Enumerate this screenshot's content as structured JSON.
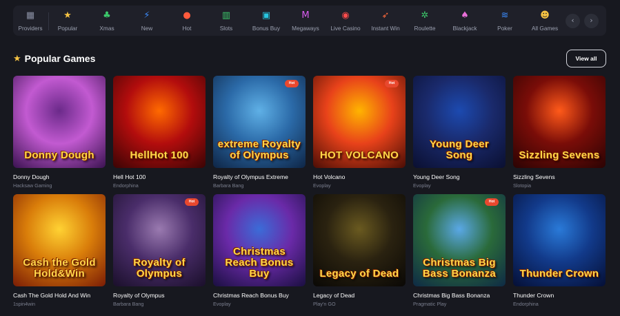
{
  "nav": {
    "items": [
      {
        "label": "Providers",
        "icon": "grid-icon",
        "glyph": "▦",
        "color": "#8a8fa3"
      },
      {
        "label": "Popular",
        "icon": "star-icon",
        "glyph": "★",
        "color": "#f6c343"
      },
      {
        "label": "Xmas",
        "icon": "christmas-tree-icon",
        "glyph": "♣",
        "color": "#3cc96b"
      },
      {
        "label": "New",
        "icon": "lightning-icon",
        "glyph": "⚡",
        "color": "#3b8cff"
      },
      {
        "label": "Hot",
        "icon": "flame-icon",
        "glyph": "●",
        "color": "#ff5a3c"
      },
      {
        "label": "Slots",
        "icon": "slot-reels-icon",
        "glyph": "▥",
        "color": "#3cc96b"
      },
      {
        "label": "Bonus Buy",
        "icon": "bonus-buy-icon",
        "glyph": "▣",
        "color": "#27c6e0"
      },
      {
        "label": "Megaways",
        "icon": "megaways-icon",
        "glyph": "M",
        "color": "#d95cf0"
      },
      {
        "label": "Live Casino",
        "icon": "live-casino-icon",
        "glyph": "◉",
        "color": "#ff4b4b"
      },
      {
        "label": "Instant Win",
        "icon": "rocket-icon",
        "glyph": "➶",
        "color": "#ff6a3c"
      },
      {
        "label": "Roulette",
        "icon": "roulette-icon",
        "glyph": "✲",
        "color": "#3cc96b"
      },
      {
        "label": "Blackjack",
        "icon": "spade-icon",
        "glyph": "♠",
        "color": "#e86fd8"
      },
      {
        "label": "Poker",
        "icon": "poker-chips-icon",
        "glyph": "≋",
        "color": "#3b8cff"
      },
      {
        "label": "All Games",
        "icon": "smiley-icon",
        "glyph": "☻",
        "color": "#f6c343"
      }
    ],
    "prev_glyph": "‹",
    "next_glyph": "›"
  },
  "section": {
    "title": "Popular Games",
    "view_all": "View all"
  },
  "games": [
    {
      "name": "Donny Dough",
      "provider": "Hacksaw Gaming",
      "art_title": "Donny Dough",
      "colors": [
        "#6b2a8a",
        "#c25ad1",
        "#3a1250"
      ]
    },
    {
      "name": "Hell Hot 100",
      "provider": "Endorphina",
      "art_title": "HellHot 100",
      "colors": [
        "#ff6a00",
        "#b30d0d",
        "#3a0404"
      ]
    },
    {
      "name": "Royalty of Olympus Extreme",
      "provider": "Barbara Bang",
      "art_title": "extreme Royalty of Olympus",
      "colors": [
        "#5fb0e6",
        "#2b6aa8",
        "#0e2545"
      ],
      "badge": "Hot"
    },
    {
      "name": "Hot Volcano",
      "provider": "Evoplay",
      "art_title": "HOT VOLCANO",
      "colors": [
        "#ffb400",
        "#e8421a",
        "#4a0d05"
      ],
      "badge": "Hot"
    },
    {
      "name": "Young Deer Song",
      "provider": "Evoplay",
      "art_title": "Young Deer Song",
      "colors": [
        "#1c4ab0",
        "#1a2a6c",
        "#0a0f30"
      ]
    },
    {
      "name": "Sizzling Sevens",
      "provider": "Slotopia",
      "art_title": "Sizzling Sevens",
      "colors": [
        "#ff5a1a",
        "#7a0d08",
        "#2a0303"
      ]
    },
    {
      "name": "Cash The Gold Hold And Win",
      "provider": "1spin4win",
      "art_title": "Cash the Gold Hold&Win",
      "colors": [
        "#ffd233",
        "#d97d0a",
        "#7a1c05"
      ]
    },
    {
      "name": "Royalty of Olympus",
      "provider": "Barbara Bang",
      "art_title": "Royalty of Olympus",
      "colors": [
        "#9a7ab0",
        "#4a2d6a",
        "#1a0f2a"
      ],
      "badge": "Hot"
    },
    {
      "name": "Christmas Reach Bonus Buy",
      "provider": "Evoplay",
      "art_title": "Christmas Reach Bonus Buy",
      "colors": [
        "#3b6cd8",
        "#6a2aa8",
        "#1a0f40"
      ]
    },
    {
      "name": "Legacy of Dead",
      "provider": "Play'n GO",
      "art_title": "Legacy of Dead",
      "colors": [
        "#6a5a20",
        "#2a2210",
        "#0a0805"
      ]
    },
    {
      "name": "Christmas Big Bass Bonanza",
      "provider": "Pragmatic Play",
      "art_title": "Christmas Big Bass Bonanza",
      "colors": [
        "#5aa8e6",
        "#2a6a3a",
        "#0e2a45"
      ],
      "badge": "Hot"
    },
    {
      "name": "Thunder Crown",
      "provider": "Endorphina",
      "art_title": "Thunder Crown",
      "colors": [
        "#2a7ad8",
        "#123a8a",
        "#050f35"
      ]
    }
  ]
}
